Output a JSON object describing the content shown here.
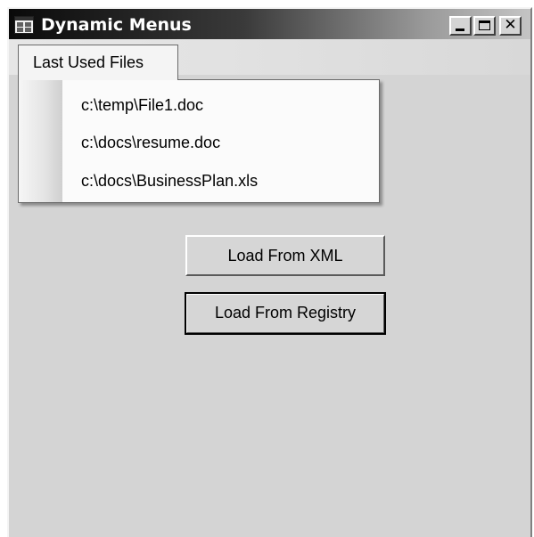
{
  "window": {
    "title": "Dynamic Menus",
    "icon": "app-window-icon",
    "controls": {
      "minimize": "minimize-icon",
      "maximize": "maximize-icon",
      "close_glyph": "✕"
    }
  },
  "menu": {
    "top_label": "Last Used Files",
    "items": [
      {
        "label": "c:\\temp\\File1.doc"
      },
      {
        "label": "c:\\docs\\resume.doc"
      },
      {
        "label": "c:\\docs\\BusinessPlan.xls"
      }
    ]
  },
  "buttons": {
    "load_xml": "Load From XML",
    "load_registry": "Load From Registry"
  },
  "colors": {
    "title_gradient_start": "#0a0a0a",
    "title_gradient_end": "#c4c4c4",
    "form_background": "#d4d4d4"
  }
}
